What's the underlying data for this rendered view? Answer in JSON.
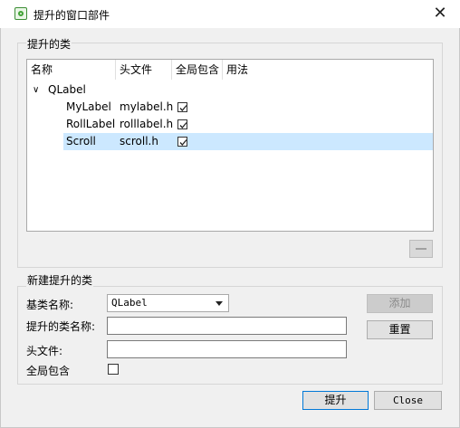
{
  "window": {
    "title": "提升的窗口部件",
    "close_glyph": "✕"
  },
  "promoted_group": {
    "title": "提升的类",
    "columns": [
      "名称",
      "头文件",
      "全局包含",
      "用法"
    ],
    "parent_node": {
      "expander": "∨",
      "name": "QLabel"
    },
    "rows": [
      {
        "name": "MyLabel",
        "header": "mylabel.h",
        "global_include": true,
        "selected": false
      },
      {
        "name": "RollLabel",
        "header": "rolllabel.h",
        "global_include": true,
        "selected": false
      },
      {
        "name": "Scroll",
        "header": "scroll.h",
        "global_include": true,
        "selected": true
      }
    ],
    "remove_button_enabled": false
  },
  "new_group": {
    "title": "新建提升的类",
    "base_class_label": "基类名称:",
    "base_class_value": "QLabel",
    "promoted_name_label": "提升的类名称:",
    "promoted_name_value": "",
    "header_label": "头文件:",
    "header_value": "",
    "global_include_label": "全局包含",
    "global_include_checked": false,
    "add_button": "添加",
    "reset_button": "重置"
  },
  "footer": {
    "promote_button": "提升",
    "close_button": "Close"
  },
  "colors": {
    "dialog_bg": "#f0f0f0",
    "selection": "#cce8ff",
    "default_button_border": "#0078d7"
  }
}
